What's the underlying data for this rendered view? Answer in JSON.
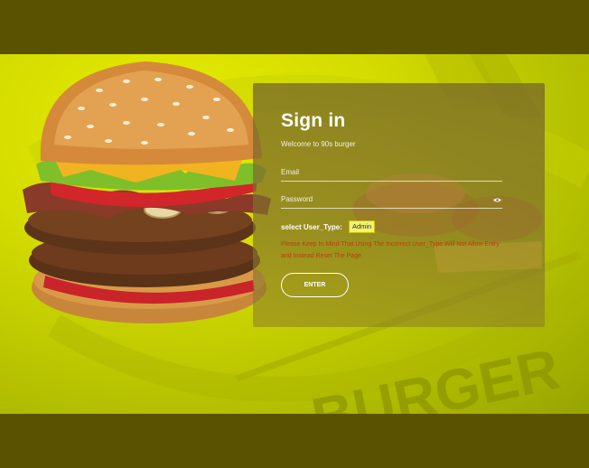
{
  "colors": {
    "page_bg": "#5a5200",
    "hero_yellow": "#d4dc00",
    "card_overlay": "#786928",
    "warning_text": "#c23a10",
    "badge_bg": "#f2f07a"
  },
  "decor": {
    "background_word": "BURGER"
  },
  "form": {
    "title": "Sign in",
    "subtitle": "Welcome to 90s burger",
    "email_label": "Email",
    "password_label": "Password",
    "password_toggle_icon": "eye-icon",
    "user_type_label": "select User_Type:",
    "user_type_value": "Admin",
    "warning": "Please Keep In Mind That Using The Incorrect User_Type Will Not Allow Entry and Instead Reset The Page",
    "enter_label": "ENTER"
  }
}
